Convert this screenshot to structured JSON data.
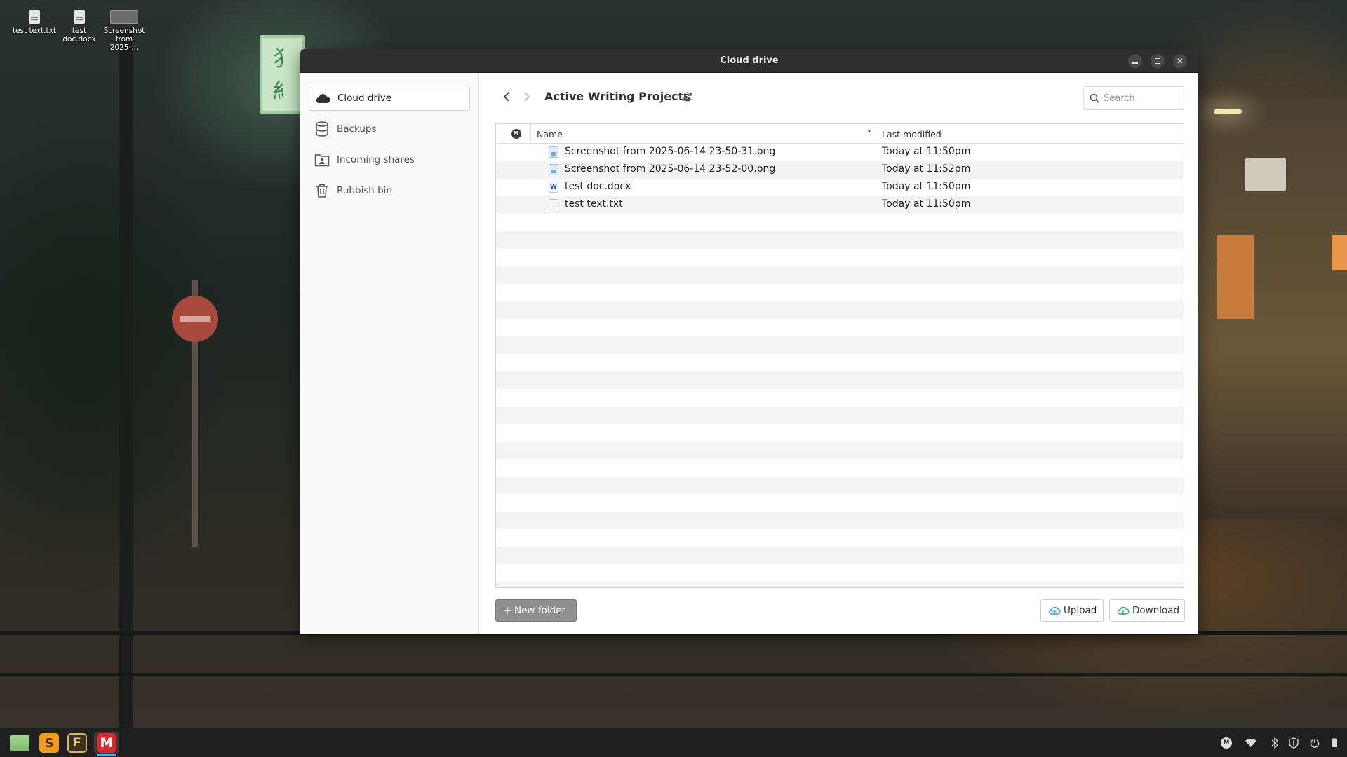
{
  "desktop": {
    "icons": [
      {
        "label": "test text.txt",
        "icon": "text-file-icon"
      },
      {
        "label": "test doc.docx",
        "icon": "document-file-icon"
      },
      {
        "label": "Screenshot from 2025-...",
        "icon": "image-thumbnail-icon"
      }
    ]
  },
  "window": {
    "title": "Cloud drive"
  },
  "sidebar": {
    "items": [
      {
        "label": "Cloud drive",
        "icon": "cloud-icon",
        "active": true
      },
      {
        "label": "Backups",
        "icon": "database-icon",
        "active": false
      },
      {
        "label": "Incoming shares",
        "icon": "contact-folder-icon",
        "active": false
      },
      {
        "label": "Rubbish bin",
        "icon": "trash-icon",
        "active": false
      }
    ]
  },
  "main": {
    "current_folder": "Active Writing Projects",
    "search": {
      "placeholder": "Search",
      "value": ""
    },
    "table": {
      "mega_badge": "M",
      "columns": {
        "name": "Name",
        "modified": "Last modified"
      },
      "rows": [
        {
          "name": "Screenshot from 2025-06-14 23-50-31.png",
          "modified": "Today at 11:50pm",
          "type": "png"
        },
        {
          "name": "Screenshot from 2025-06-14 23-52-00.png",
          "modified": "Today at 11:52pm",
          "type": "png"
        },
        {
          "name": "test doc.docx",
          "modified": "Today at 11:50pm",
          "type": "docx",
          "type_glyph": "W"
        },
        {
          "name": "test text.txt",
          "modified": "Today at 11:50pm",
          "type": "txt"
        }
      ]
    },
    "buttons": {
      "new_folder": "New folder",
      "upload": "Upload",
      "download": "Download"
    }
  },
  "taskbar": {
    "apps": [
      {
        "name": "files-app-icon"
      },
      {
        "name": "sublime-text-icon",
        "glyph": "S"
      },
      {
        "name": "f-app-icon",
        "glyph": "F"
      },
      {
        "name": "mega-app-icon",
        "glyph": "M",
        "active": true
      }
    ],
    "tray": {
      "mega_glyph": "M"
    }
  }
}
